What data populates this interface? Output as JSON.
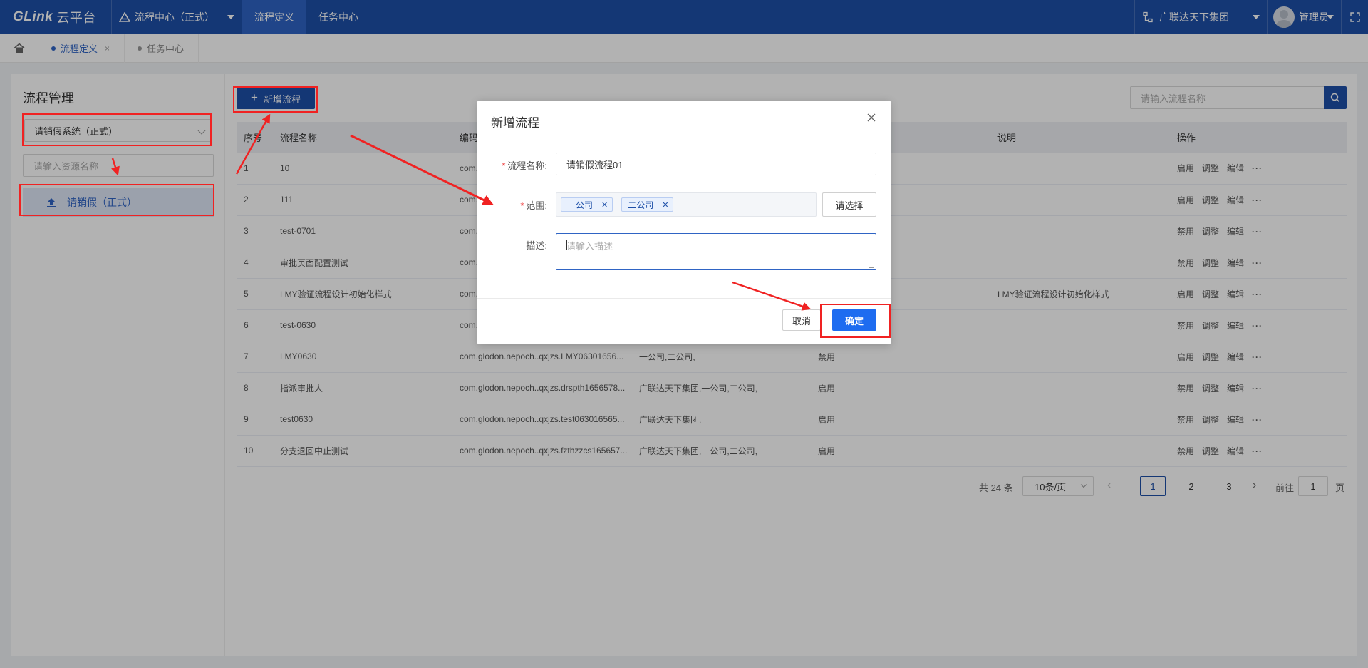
{
  "topbar": {
    "logo_en": "GLink",
    "logo_cn": "云平台",
    "system": "流程中心（正式）",
    "nav_tabs": [
      "流程定义",
      "任务中心"
    ],
    "org": "广联达天下集团",
    "user": "管理员",
    "accent": "#1d4fa8"
  },
  "tabs": {
    "items": [
      "流程定义",
      "任务中心"
    ],
    "close_glyph": "×"
  },
  "left": {
    "title": "流程管理",
    "system_select": "请销假系统（正式）",
    "search_placeholder": "请输入资源名称",
    "tree_item": "请销假（正式）"
  },
  "right": {
    "add_button": "新增流程",
    "search_placeholder": "请输入流程名称",
    "columns": [
      "序号",
      "流程名称",
      "编码",
      "范围",
      "状态",
      "说明",
      "操作"
    ],
    "rows": [
      {
        "no": "1",
        "name": "10",
        "code": "com.",
        "scope": "",
        "status": "",
        "desc": "",
        "ops": [
          "启用",
          "调整",
          "编辑",
          "···"
        ]
      },
      {
        "no": "2",
        "name": "111",
        "code": "com.",
        "scope": "",
        "status": "",
        "desc": "",
        "ops": [
          "启用",
          "调整",
          "编辑",
          "···"
        ]
      },
      {
        "no": "3",
        "name": "test-0701",
        "code": "com.",
        "scope": "",
        "status": "",
        "desc": "",
        "ops": [
          "禁用",
          "调整",
          "编辑",
          "···"
        ]
      },
      {
        "no": "4",
        "name": "审批页面配置测试",
        "code": "com.",
        "scope": "",
        "status": "",
        "desc": "",
        "ops": [
          "禁用",
          "调整",
          "编辑",
          "···"
        ]
      },
      {
        "no": "5",
        "name": "LMY验证流程设计初始化样式",
        "code": "com.",
        "scope": "",
        "status": "",
        "desc": "LMY验证流程设计初始化样式",
        "ops": [
          "启用",
          "调整",
          "编辑",
          "···"
        ]
      },
      {
        "no": "6",
        "name": "test-0630",
        "code": "com.",
        "scope": "",
        "status": "",
        "desc": "",
        "ops": [
          "禁用",
          "调整",
          "编辑",
          "···"
        ]
      },
      {
        "no": "7",
        "name": "LMY0630",
        "code": "com.glodon.nepoch..qxjzs.LMY06301656...",
        "scope": "一公司,二公司,",
        "status": "禁用",
        "desc": "",
        "ops": [
          "启用",
          "调整",
          "编辑",
          "···"
        ]
      },
      {
        "no": "8",
        "name": "指派审批人",
        "code": "com.glodon.nepoch..qxjzs.drspth1656578...",
        "scope": "广联达天下集团,一公司,二公司,",
        "status": "启用",
        "desc": "",
        "ops": [
          "禁用",
          "调整",
          "编辑",
          "···"
        ]
      },
      {
        "no": "9",
        "name": "test0630",
        "code": "com.glodon.nepoch..qxjzs.test063016565...",
        "scope": "广联达天下集团,",
        "status": "启用",
        "desc": "",
        "ops": [
          "禁用",
          "调整",
          "编辑",
          "···"
        ]
      },
      {
        "no": "10",
        "name": "分支退回中止测试",
        "code": "com.glodon.nepoch..qxjzs.fzthzzcs165657...",
        "scope": "广联达天下集团,一公司,二公司,",
        "status": "启用",
        "desc": "",
        "ops": [
          "禁用",
          "调整",
          "编辑",
          "···"
        ]
      }
    ],
    "pager": {
      "total": "共 24 条",
      "page_size": "10条/页",
      "pages": [
        "1",
        "2",
        "3"
      ],
      "current": "1",
      "goto_label": "前往",
      "goto_value": "1",
      "page_word": "页"
    }
  },
  "modal": {
    "title": "新增流程",
    "name_label": "流程名称:",
    "name_value": "请销假流程01",
    "scope_label": "范围:",
    "scope_tags": [
      "一公司",
      "二公司"
    ],
    "choose_button": "请选择",
    "desc_label": "描述:",
    "desc_placeholder": "请输入描述",
    "cancel": "取消",
    "ok": "确定",
    "ok_color": "#1e6cf0"
  },
  "annotation_color": "#f02222"
}
